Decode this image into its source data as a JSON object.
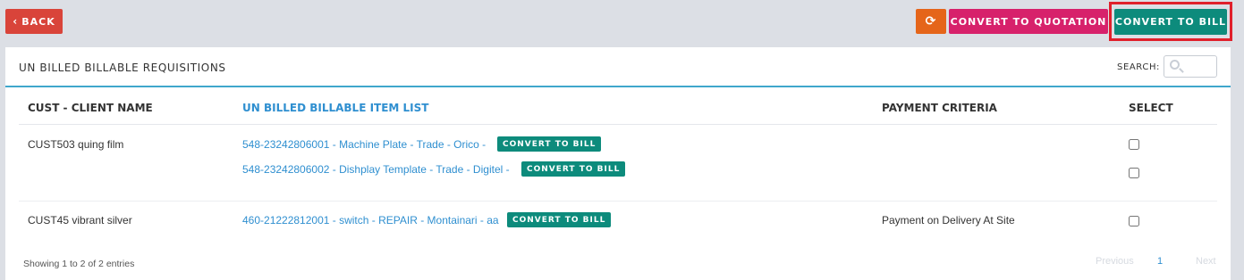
{
  "toolbar": {
    "back_label": "BACK",
    "refresh_icon": "refresh-icon",
    "convert_to_quotation_label": "CONVERT TO QUOTATION",
    "convert_to_bill_label": "CONVERT TO BILL",
    "colors": {
      "back": "#d9443a",
      "refresh": "#e5651a",
      "quotation": "#d7216b",
      "bill": "#0d8b7c",
      "highlight": "#e0202b"
    }
  },
  "panel": {
    "title": "UN BILLED BILLABLE REQUISITIONS",
    "search_label": "SEARCH:",
    "search_value": ""
  },
  "table": {
    "columns": [
      "CUST - CLIENT NAME",
      "UN BILLED BILLABLE ITEM LIST",
      "PAYMENT CRITERIA",
      "SELECT"
    ],
    "rows": [
      {
        "client": "CUST503 quing film",
        "payment": "",
        "items": [
          {
            "text": "548-23242806001 - Machine Plate - Trade - Orico -",
            "button": "CONVERT TO BILL",
            "selected": false
          },
          {
            "text": "548-23242806002 - Dishplay Template - Trade - Digitel -",
            "button": "CONVERT TO BILL",
            "selected": false
          }
        ]
      },
      {
        "client": "CUST45 vibrant silver",
        "payment": "Payment on Delivery At Site",
        "items": [
          {
            "text": "460-21222812001 - switch - REPAIR - Montainari - aa",
            "button": "CONVERT TO BILL",
            "selected": false
          }
        ]
      }
    ]
  },
  "footer": {
    "info": "Showing 1 to 2 of 2 entries",
    "pagination": {
      "previous": "Previous",
      "current": "1",
      "next": "Next"
    }
  }
}
